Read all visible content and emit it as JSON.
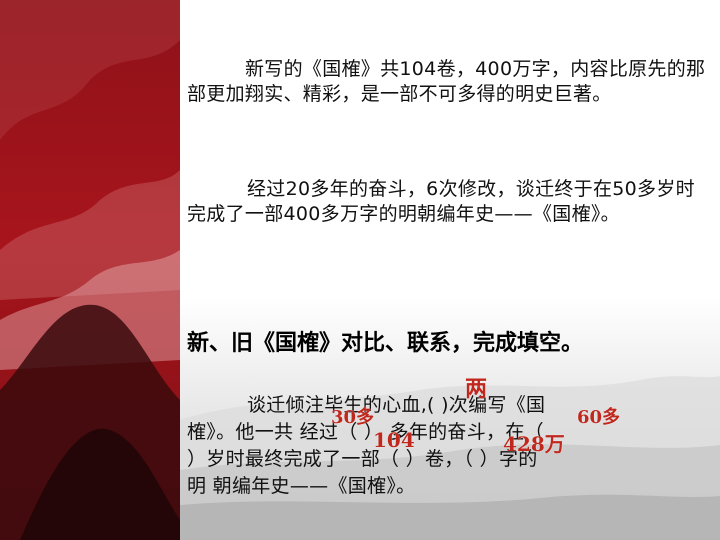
{
  "paragraph_1": "新写的《国榷》共104卷，400万字，内容比原先的那部更加翔实、精彩，是一部不可多得的明史巨著。",
  "paragraph_2": "经过20多年的奋斗，6次修改，谈迁终于在50多岁时完成了一部400多万字的明朝编年史——《国榷》。",
  "heading": "新、旧《国榷》对比、联系，完成填空。",
  "fill_in": {
    "line_1": "谈迁倾注毕生的心血,(      )次编写《国",
    "line_2": "榷》。他一共 经过（      ） 多年的奋斗，在（",
    "line_3": "）岁时最终完成了一部（      ）卷，（         ）字的",
    "line_4": "明 朝编年史——《国榷》。"
  },
  "answers": {
    "times": "两",
    "years": "30多",
    "age": "60多",
    "volumes": "104",
    "words": "428万"
  },
  "colors": {
    "strip": "#a8141c",
    "answer": "#c0281e",
    "text": "#111111"
  }
}
